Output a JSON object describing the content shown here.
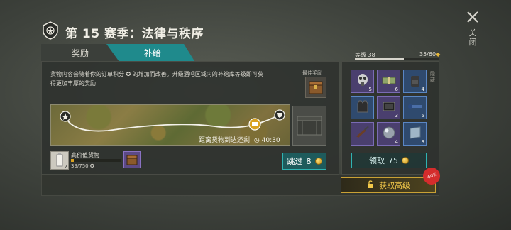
{
  "header": {
    "title": "第 15 赛季：法律与秩序",
    "close_label": "关闭",
    "close_icon": "close-icon",
    "badge_icon": "season-badge-icon"
  },
  "tabs": [
    {
      "label": "奖励",
      "active": false
    },
    {
      "label": "补给",
      "active": true
    }
  ],
  "supply": {
    "description": "货物内容会随着你的订单积分 ✪ 的增加而改善。升级酒吧区域内的补给库等级即可获得更加丰厚的奖励!",
    "best_reward_label": "最佳奖励",
    "eta_label": "距离货物到达还剩:",
    "eta_time": "40:30",
    "goods": {
      "name": "高价值货物",
      "count_badge": "2",
      "progress_text": "39/750 ✪",
      "progress_value": 39,
      "progress_max": 750
    },
    "skip_button": {
      "label": "跳过",
      "cost": "8"
    }
  },
  "level": {
    "label": "等级 38",
    "count": "35/60",
    "progress_fraction": 0.583
  },
  "rewards_grid": [
    {
      "icon": "gas-mask-icon",
      "qty": "5",
      "rarity": "purple"
    },
    {
      "icon": "cash-bundle-icon",
      "qty": "6",
      "rarity": "purple"
    },
    {
      "icon": "backpack-icon",
      "qty": "4",
      "rarity": "blue"
    },
    {
      "icon": "armor-vest-icon",
      "qty": "",
      "rarity": "blue"
    },
    {
      "icon": "tablet-icon",
      "qty": "3",
      "rarity": "purple"
    },
    {
      "icon": "scope-icon",
      "qty": "5",
      "rarity": "blue"
    },
    {
      "icon": "rifle-icon",
      "qty": "",
      "rarity": "purple"
    },
    {
      "icon": "sphere-icon",
      "qty": "4",
      "rarity": "purple"
    },
    {
      "icon": "plate-icon",
      "qty": "3",
      "rarity": "blue"
    }
  ],
  "claim_button": {
    "label": "领取",
    "amount": "75"
  },
  "premium_button": {
    "label": "获取高级",
    "discount": "-60%"
  },
  "side_toggle_label": "隐藏",
  "colors": {
    "accent_teal": "#1f8a8c",
    "premium_gold": "#f3c94a",
    "discount_red": "#d42c2c"
  }
}
